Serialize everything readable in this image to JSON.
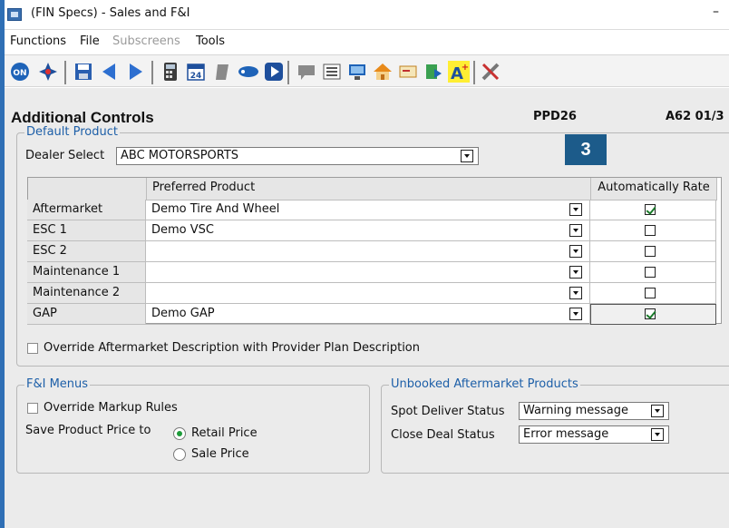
{
  "window": {
    "title": "(FIN Specs) - Sales and F&I",
    "minimize_glyph": "–"
  },
  "menu": {
    "functions": "Functions",
    "file": "File",
    "subscreens": "Subscreens",
    "tools": "Tools"
  },
  "toolbar": {
    "icons": [
      "on-icon",
      "compass-icon",
      "save-icon",
      "back-icon",
      "forward-icon",
      "calculator-icon",
      "calendar-icon",
      "document-gray-icon",
      "tag-icon",
      "play-icon",
      "comment-icon",
      "list-icon",
      "monitor-icon",
      "home-icon",
      "card-icon",
      "export-icon",
      "text-a-plus-icon",
      "tools-icon"
    ],
    "calendar_day": "24"
  },
  "page": {
    "title": "Additional Controls",
    "screen_code": "PPD26",
    "screen_number": "A62 01/3",
    "badge": "3"
  },
  "default_product": {
    "legend": "Default Product",
    "dealer_label": "Dealer Select",
    "dealer_value": "ABC MOTORSPORTS",
    "columns": {
      "product": "Preferred Product",
      "auto_rate": "Automatically Rate"
    },
    "rows": [
      {
        "label": "Aftermarket",
        "product": "Demo Tire And Wheel",
        "auto_rate": true
      },
      {
        "label": "ESC 1",
        "product": "Demo VSC",
        "auto_rate": false
      },
      {
        "label": "ESC 2",
        "product": "",
        "auto_rate": false
      },
      {
        "label": "Maintenance 1",
        "product": "",
        "auto_rate": false
      },
      {
        "label": "Maintenance 2",
        "product": "",
        "auto_rate": false
      },
      {
        "label": "GAP",
        "product": "Demo GAP",
        "auto_rate": true
      }
    ],
    "override_label": "Override Aftermarket Description with Provider Plan Description",
    "override_checked": false
  },
  "fi_menus": {
    "legend": "F&I Menus",
    "override_markup_label": "Override Markup Rules",
    "override_markup_checked": false,
    "save_price_label": "Save Product Price to",
    "options": [
      "Retail Price",
      "Sale Price"
    ],
    "selected": "Retail Price"
  },
  "unbooked": {
    "legend": "Unbooked Aftermarket Products",
    "spot_label": "Spot Deliver Status",
    "spot_value": "Warning message",
    "close_label": "Close Deal Status",
    "close_value": "Error message"
  },
  "colors": {
    "accent": "#1d5fa8",
    "badge": "#1c5b8a",
    "check": "#1a7a2a"
  }
}
